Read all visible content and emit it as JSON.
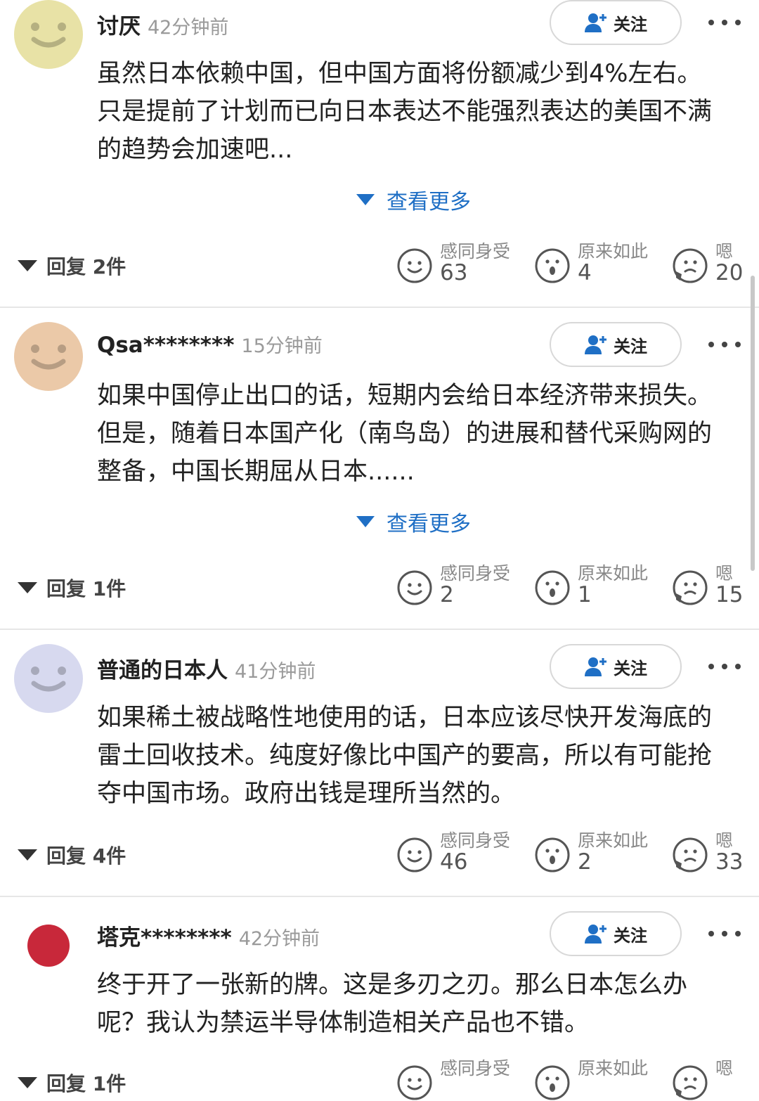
{
  "theme": {
    "accent": "#1f6fc5",
    "divider": "#e6e6e6",
    "muted": "#9a9a9a"
  },
  "follow_label": "关注",
  "see_more_label": "查看更多",
  "reaction_labels": {
    "empathy": "感同身受",
    "insight": "原来如此",
    "hmm": "嗯"
  },
  "comments": [
    {
      "username": "讨厌",
      "time": "42分钟前",
      "avatar": {
        "color": "#e8e2a6",
        "icon": "smile-face"
      },
      "lines": [
        "虽然日本依赖中国，但中国方面将份额减少到4%左右。",
        "只是提前了计划而已向日本表达不能强烈表达的美国不满",
        "的趋势会加速吧..."
      ],
      "see_more": true,
      "reply": "回复 2件",
      "counts": {
        "empathy": "63",
        "insight": "4",
        "hmm": "20"
      }
    },
    {
      "username": "Qsa********",
      "time": "15分钟前",
      "avatar": {
        "color": "#ebc9a8",
        "icon": "smile-face"
      },
      "lines": [
        "如果中国停止出口的话，短期内会给日本经济带来损失。",
        "但是，随着日本国产化（南鸟岛）的进展和替代采购网的",
        "整备，中国长期屈从日本......"
      ],
      "see_more": true,
      "reply": "回复 1件",
      "counts": {
        "empathy": "2",
        "insight": "1",
        "hmm": "15"
      }
    },
    {
      "username": "普通的日本人",
      "time": "41分钟前",
      "avatar": {
        "color": "#d7d9ef",
        "icon": "smile-face"
      },
      "lines": [
        "如果稀土被战略性地使用的话，日本应该尽快开发海底的",
        "雷土回收技术。纯度好像比中国产的要高，所以有可能抢",
        "夺中国市场。政府出钱是理所当然的。"
      ],
      "see_more": false,
      "reply": "回复 4件",
      "counts": {
        "empathy": "46",
        "insight": "2",
        "hmm": "33"
      }
    },
    {
      "username": "塔克********",
      "time": "42分钟前",
      "avatar": {
        "color": "#c8283a",
        "icon": "red-circle"
      },
      "lines": [
        "终于开了一张新的牌。这是多刃之刃。那么日本怎么办",
        "呢？我认为禁运半导体制造相关产品也不错。"
      ],
      "see_more": false,
      "reply": "回复 1件",
      "counts": {
        "empathy": "",
        "insight": "",
        "hmm": ""
      }
    }
  ]
}
